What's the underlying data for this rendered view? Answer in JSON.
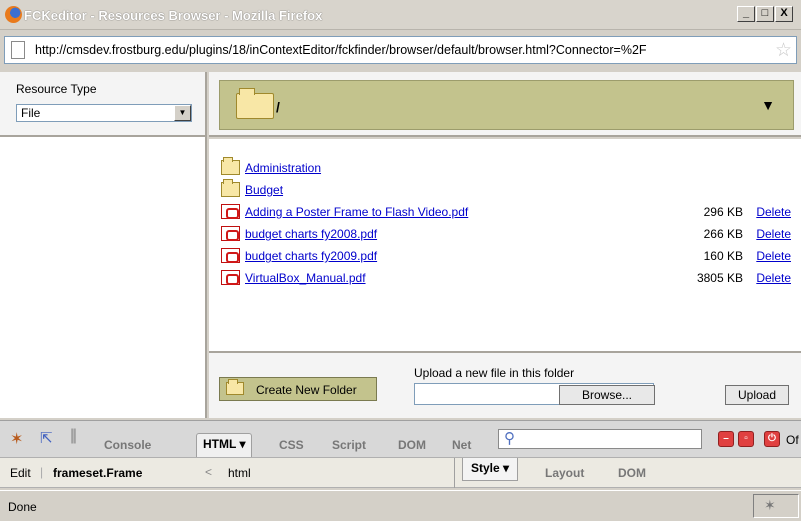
{
  "window": {
    "title": "FCKeditor - Resources Browser - Mozilla Firefox",
    "minimize": "_",
    "maximize": "□",
    "close": "X"
  },
  "urlbar": {
    "url": "http://cmsdev.frostburg.edu/plugins/18/inContextEditor/fckfinder/browser/default/browser.html?Connector=%2F"
  },
  "sidebar": {
    "resource_type_label": "Resource Type",
    "resource_type_value": "File"
  },
  "path": {
    "current": "/"
  },
  "files": [
    {
      "type": "folder",
      "name": "Administration",
      "size": "",
      "delete": ""
    },
    {
      "type": "folder",
      "name": "Budget",
      "size": "",
      "delete": ""
    },
    {
      "type": "pdf",
      "name": "Adding a Poster Frame to Flash Video.pdf",
      "size": "296 KB",
      "delete": "Delete"
    },
    {
      "type": "pdf",
      "name": "budget charts fy2008.pdf",
      "size": "266 KB",
      "delete": "Delete"
    },
    {
      "type": "pdf",
      "name": "budget charts fy2009.pdf",
      "size": "160 KB",
      "delete": "Delete"
    },
    {
      "type": "pdf",
      "name": "VirtualBox_Manual.pdf",
      "size": "3805 KB",
      "delete": "Delete"
    }
  ],
  "upload": {
    "create_folder": "Create New Folder",
    "label": "Upload a new file in this folder",
    "browse": "Browse...",
    "upload": "Upload"
  },
  "firebug": {
    "tabs": [
      "Console",
      "HTML ▾",
      "CSS",
      "Script",
      "DOM",
      "Net"
    ],
    "off_label": "Of",
    "edit": "Edit",
    "frame": "frameset.Frame",
    "crumb_sep": "<",
    "crumb_html": "html",
    "side_tabs": [
      "Style ▾",
      "Layout",
      "DOM"
    ]
  },
  "status": {
    "text": "Done"
  },
  "colors": {
    "panel_olive": "#c3c38d",
    "link_blue": "#0000cc"
  }
}
